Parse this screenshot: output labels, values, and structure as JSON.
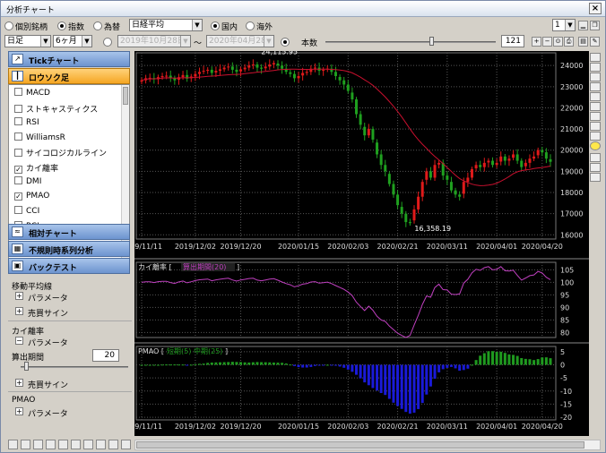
{
  "window": {
    "title": "分析チャート",
    "close": "×"
  },
  "toolbar": {
    "radio_individual": "個別銘柄",
    "radio_index": "指数",
    "radio_fx": "為替",
    "index_select": "日経平均",
    "radio_domestic": "国内",
    "radio_overseas": "海外",
    "period_unit": "日足",
    "period_range": "6ヶ月",
    "date_from": "2019年10月28日",
    "date_to": "2020年04月28日",
    "tilde": "〜",
    "bars_label": "本数",
    "bars_value": "121",
    "count_select": "1"
  },
  "sidebar": {
    "tick_chart": "Tickチャート",
    "candle": "ロウソク足",
    "indicators": [
      {
        "label": "MACD",
        "checked": false
      },
      {
        "label": "ストキャスティクス",
        "checked": false
      },
      {
        "label": "RSI",
        "checked": false
      },
      {
        "label": "WilliamsR",
        "checked": false
      },
      {
        "label": "サイコロジカルライン",
        "checked": false
      },
      {
        "label": "カイ離率",
        "checked": true
      },
      {
        "label": "DMI",
        "checked": false
      },
      {
        "label": "PMAO",
        "checked": true
      },
      {
        "label": "CCI",
        "checked": false
      },
      {
        "label": "RCI",
        "checked": false
      }
    ],
    "relative_chart": "相対チャート",
    "irregular": "不規則時系列分析",
    "backtest": "バックテスト"
  },
  "params": {
    "ma_title": "移動平均線",
    "ma_param": "パラメータ",
    "ma_signal": "売買サイン",
    "dev_title": "カイ離率",
    "dev_param": "パラメータ",
    "dev_period_label": "算出期間",
    "dev_period_value": "20",
    "dev_signal": "売買サイン",
    "pmao_title": "PMAO",
    "pmao_param": "パラメータ"
  },
  "chart": {
    "main_high_label": "24,115.95",
    "main_low_label": "16,358.19",
    "price_ticks": [
      "24000",
      "23000",
      "22000",
      "21000",
      "20000",
      "19000",
      "18000",
      "17000",
      "16000"
    ],
    "date_ticks": [
      "2019/11/11",
      "2019/12/02",
      "2019/12/20",
      "2020/01/15",
      "2020/02/03",
      "2020/02/21",
      "2020/03/11",
      "2020/04/01",
      "2020/04/20"
    ],
    "dev_title": "カイ離率 [",
    "dev_sub": "算出期間(20)",
    "dev_close": "]",
    "dev_ticks": [
      "105",
      "100",
      "95",
      "90",
      "85",
      "80"
    ],
    "pmao_title": "PMAO [",
    "pmao_short": "短期(5)",
    "pmao_mid": "中期(25)",
    "pmao_close": "]",
    "pmao_ticks": [
      "5",
      "0",
      "-5",
      "-10",
      "-15",
      "-20"
    ],
    "colors": {
      "up": "#e01a1a",
      "down": "#1fa01f",
      "ma": "#c8102e",
      "dev": "#c040c0",
      "pmao_pos": "#1f9a1f",
      "pmao_neg": "#1a1ad8",
      "grid": "#555"
    }
  },
  "chart_data": {
    "type": "candlestick",
    "title": "",
    "price_range": [
      15800,
      24600
    ],
    "close": [
      23300,
      23400,
      23420,
      23350,
      23450,
      23500,
      23520,
      23400,
      23300,
      23450,
      23550,
      23380,
      23480,
      23600,
      23700,
      23750,
      23800,
      23650,
      23750,
      23820,
      23900,
      23950,
      23800,
      23700,
      23820,
      23900,
      24000,
      24050,
      23900,
      23850,
      23950,
      24050,
      24115,
      24000,
      23850,
      23700,
      23600,
      23400,
      23500,
      23650,
      23700,
      23850,
      23900,
      23750,
      23800,
      23850,
      23700,
      23500,
      23300,
      23100,
      22800,
      22400,
      21700,
      21200,
      20700,
      21000,
      20500,
      19800,
      19300,
      19000,
      18400,
      17900,
      17400,
      17000,
      16600,
      16552,
      17200,
      17800,
      18500,
      19000,
      18700,
      19300,
      19400,
      18800,
      18600,
      18100,
      17900,
      17800,
      18500,
      18700,
      19100,
      19300,
      19200,
      19400,
      19500,
      19300,
      19400,
      19700,
      19500,
      19600,
      19800,
      19500,
      19200,
      19400,
      19600,
      19700,
      20000,
      19900,
      19600,
      19450
    ]
  }
}
